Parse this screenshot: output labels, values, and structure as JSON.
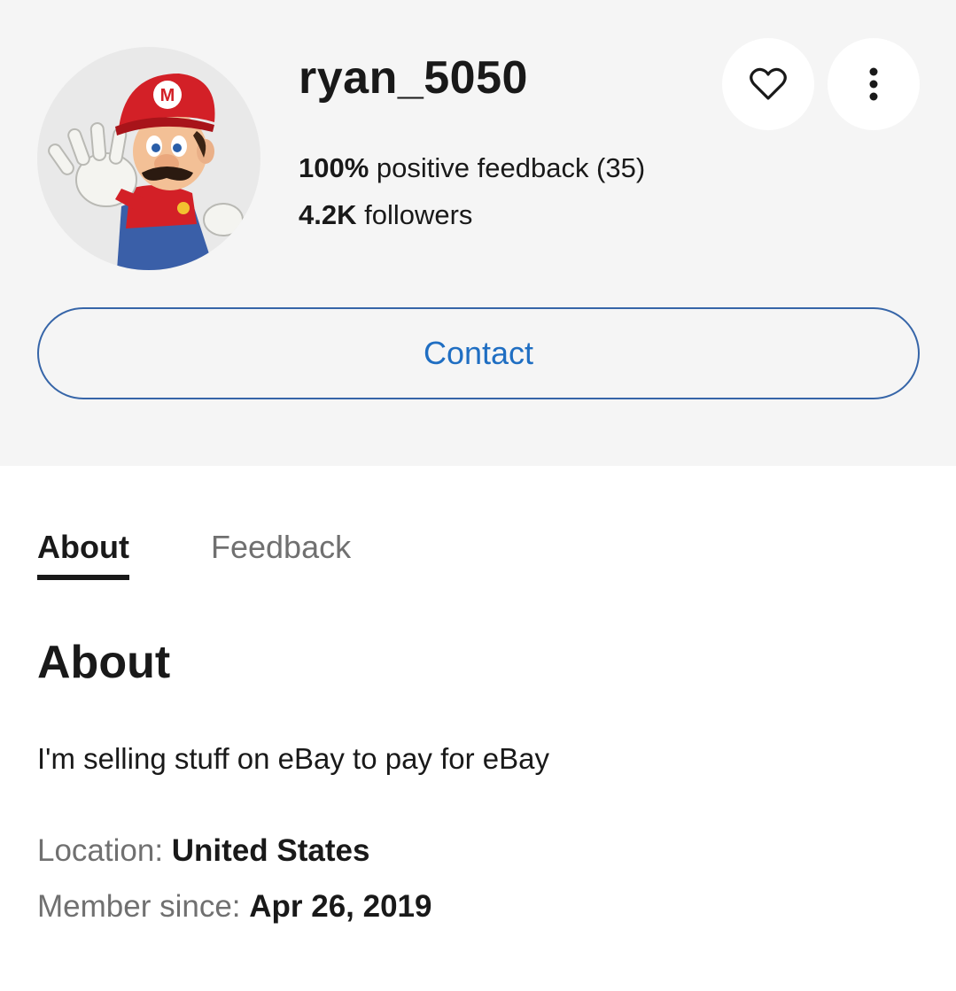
{
  "profile": {
    "username": "ryan_5050",
    "feedback_percent": "100%",
    "feedback_text": " positive feedback (35)",
    "followers_count": "4.2K",
    "followers_text": " followers",
    "avatar_icon": "mario-avatar-image"
  },
  "actions": {
    "save_icon": "heart-icon",
    "more_icon": "more-vertical-icon",
    "contact_label": "Contact"
  },
  "tabs": [
    {
      "label": "About",
      "active": true
    },
    {
      "label": "Feedback",
      "active": false
    }
  ],
  "about": {
    "heading": "About",
    "description": "I'm selling stuff on eBay to pay for eBay",
    "location_label": "Location: ",
    "location_value": "United States",
    "member_since_label": "Member since: ",
    "member_since_value": "Apr 26, 2019"
  },
  "colors": {
    "header_background": "#f5f5f5",
    "accent_blue": "#1f6ec2",
    "contact_border": "#3665a8",
    "text_primary": "#191919",
    "text_secondary": "#707070"
  }
}
